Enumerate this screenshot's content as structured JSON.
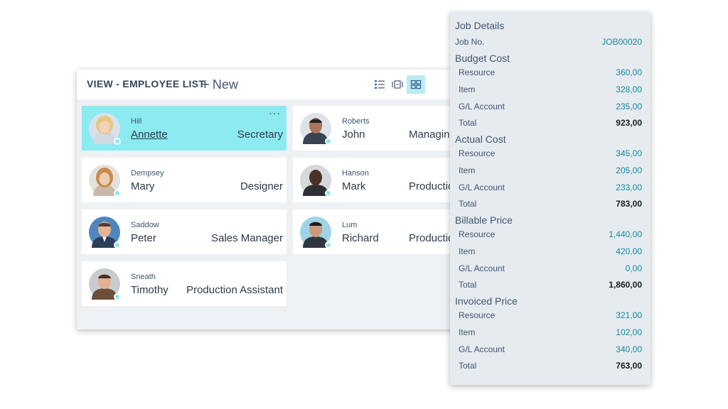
{
  "employee_list": {
    "title": "VIEW - EMPLOYEE LIST",
    "new_label": "New",
    "view_buttons": [
      "list-view-icon",
      "tile-view-icon",
      "brick-view-icon"
    ],
    "more_label": "···",
    "employees": [
      {
        "surname": "Hill",
        "first_name": "Annette",
        "job_title": "Secretary"
      },
      {
        "surname": "Roberts",
        "first_name": "John",
        "job_title": "Managing"
      },
      {
        "surname": "Dempsey",
        "first_name": "Mary",
        "job_title": "Designer"
      },
      {
        "surname": "Hanson",
        "first_name": "Mark",
        "job_title": "Production"
      },
      {
        "surname": "Saddow",
        "first_name": "Peter",
        "job_title": "Sales Manager"
      },
      {
        "surname": "Lum",
        "first_name": "Richard",
        "job_title": "Production"
      },
      {
        "surname": "Sneath",
        "first_name": "Timothy",
        "job_title": "Production Assistant"
      }
    ]
  },
  "job_details": {
    "title": "Job Details",
    "job_no_label": "Job No.",
    "job_no_value": "JOB00020",
    "sections": [
      {
        "heading": "Budget Cost",
        "rows": [
          {
            "label": "Resource",
            "value": "360,00"
          },
          {
            "label": "Item",
            "value": "328,00"
          },
          {
            "label": "G/L Account",
            "value": "235,00"
          },
          {
            "label": "Total",
            "value": "923,00"
          }
        ]
      },
      {
        "heading": "Actual Cost",
        "rows": [
          {
            "label": "Resource",
            "value": "345,00"
          },
          {
            "label": "Item",
            "value": "205,00"
          },
          {
            "label": "G/L Account",
            "value": "233,00"
          },
          {
            "label": "Total",
            "value": "783,00"
          }
        ]
      },
      {
        "heading": "Billable Price",
        "rows": [
          {
            "label": "Resource",
            "value": "1,440,00"
          },
          {
            "label": "Item",
            "value": "420,00"
          },
          {
            "label": "G/L Account",
            "value": "0,00"
          },
          {
            "label": "Total",
            "value": "1,860,00"
          }
        ]
      },
      {
        "heading": "Invoiced Price",
        "rows": [
          {
            "label": "Resource",
            "value": "321,00"
          },
          {
            "label": "Item",
            "value": "102,00"
          },
          {
            "label": "G/L Account",
            "value": "340,00"
          },
          {
            "label": "Total",
            "value": "763,00"
          }
        ]
      }
    ]
  },
  "colors": {
    "selected_card": "#8ceaf1",
    "accent_value": "#138ba0",
    "presence": "#8ee6ee"
  }
}
